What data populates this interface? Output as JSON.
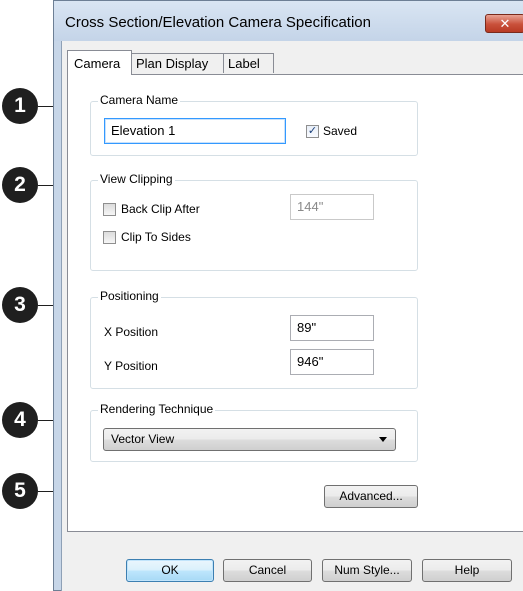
{
  "dialog": {
    "title": "Cross Section/Elevation Camera Specification",
    "close_glyph": "✕"
  },
  "tabs": [
    {
      "label": "Camera",
      "active": true
    },
    {
      "label": "Plan Display",
      "active": false
    },
    {
      "label": "Label",
      "active": false
    }
  ],
  "camera_name": {
    "group_label": "Camera Name",
    "value": "Elevation 1",
    "saved_label": "Saved",
    "saved_checked": true
  },
  "view_clipping": {
    "group_label": "View Clipping",
    "back_clip_label": "Back Clip After",
    "back_clip_checked": false,
    "back_clip_value": "144\"",
    "clip_sides_label": "Clip To Sides",
    "clip_sides_checked": false
  },
  "positioning": {
    "group_label": "Positioning",
    "x_label": "X Position",
    "x_value": "89\"",
    "y_label": "Y Position",
    "y_value": "946\""
  },
  "rendering": {
    "group_label": "Rendering Technique",
    "selected": "Vector View"
  },
  "advanced_label": "Advanced...",
  "footer": {
    "ok": "OK",
    "cancel": "Cancel",
    "num_style": "Num Style...",
    "help": "Help"
  },
  "callouts": [
    "1",
    "2",
    "3",
    "4",
    "5"
  ],
  "colors": {
    "callout": "#1f1f1f",
    "window_frame": "#c7d6e8",
    "focus_border": "#3399ff",
    "default_button": "#a7d9f5"
  }
}
